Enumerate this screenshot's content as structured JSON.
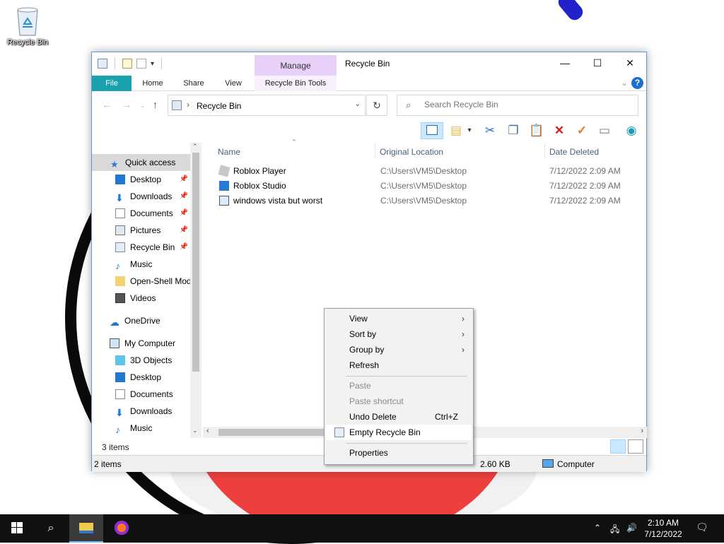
{
  "desktop": {
    "recycle_bin_label": "Recycle Bin"
  },
  "window": {
    "title": "Recycle Bin",
    "manage_tab": "Manage",
    "tabs": [
      "File",
      "Home",
      "Share",
      "View",
      "Recycle Bin Tools"
    ],
    "address": "Recycle Bin",
    "search_placeholder": "Search Recycle Bin",
    "colors": {
      "file_tab": "#19a1ad",
      "manage_tab": "#e8d1f8",
      "selection": "#cce8ff"
    }
  },
  "nav": {
    "quick_access": "Quick access",
    "quick_items": [
      "Desktop",
      "Downloads",
      "Documents",
      "Pictures",
      "Recycle Bin",
      "Music",
      "Open-Shell Mod",
      "Videos"
    ],
    "onedrive": "OneDrive",
    "my_computer": "My Computer",
    "computer_items": [
      "3D Objects",
      "Desktop",
      "Documents",
      "Downloads",
      "Music"
    ]
  },
  "columns": {
    "name": "Name",
    "location": "Original Location",
    "date": "Date Deleted"
  },
  "files": [
    {
      "name": "Roblox Player",
      "location": "C:\\Users\\VM5\\Desktop",
      "date": "7/12/2022 2:09 AM"
    },
    {
      "name": "Roblox Studio",
      "location": "C:\\Users\\VM5\\Desktop",
      "date": "7/12/2022 2:09 AM"
    },
    {
      "name": "windows vista but worst",
      "location": "C:\\Users\\VM5\\Desktop",
      "date": "7/12/2022 2:09 AM"
    }
  ],
  "status": {
    "item_count": "3 items",
    "selected": "2 items",
    "size": "2.60 KB",
    "location": "Computer"
  },
  "context_menu": {
    "view": "View",
    "sort_by": "Sort by",
    "group_by": "Group by",
    "refresh": "Refresh",
    "paste": "Paste",
    "paste_shortcut": "Paste shortcut",
    "undo_delete": "Undo Delete",
    "undo_shortcut": "Ctrl+Z",
    "empty_recycle_bin": "Empty Recycle Bin",
    "properties": "Properties"
  },
  "taskbar": {
    "time": "2:10 AM",
    "date": "7/12/2022"
  }
}
